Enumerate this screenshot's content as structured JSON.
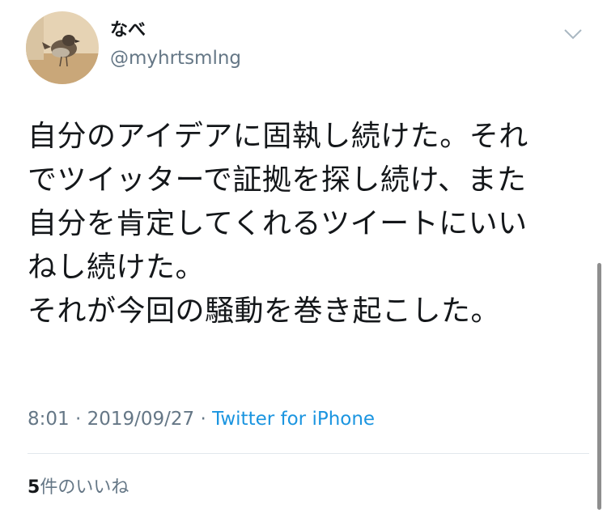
{
  "user": {
    "display_name": "なべ",
    "handle": "@myhrtsmlng",
    "avatar_icon": "sparrow-avatar-icon"
  },
  "tweet": {
    "text_lines": [
      "自分のアイデアに固執し続けた。それ",
      "でツイッターで証拠を探し続け、また",
      "自分を肯定してくれるツイートにいい",
      "ねし続けた。",
      "それが今回の騒動を巻き起こした。"
    ],
    "time": "8:01",
    "date": "2019/09/27",
    "separator": " · ",
    "source": "Twitter for iPhone"
  },
  "likes": {
    "count": "5",
    "label": "件のいいね"
  },
  "colors": {
    "text": "#14171a",
    "secondary": "#657786",
    "link": "#1b95e0",
    "divider": "#e1e8ed"
  }
}
